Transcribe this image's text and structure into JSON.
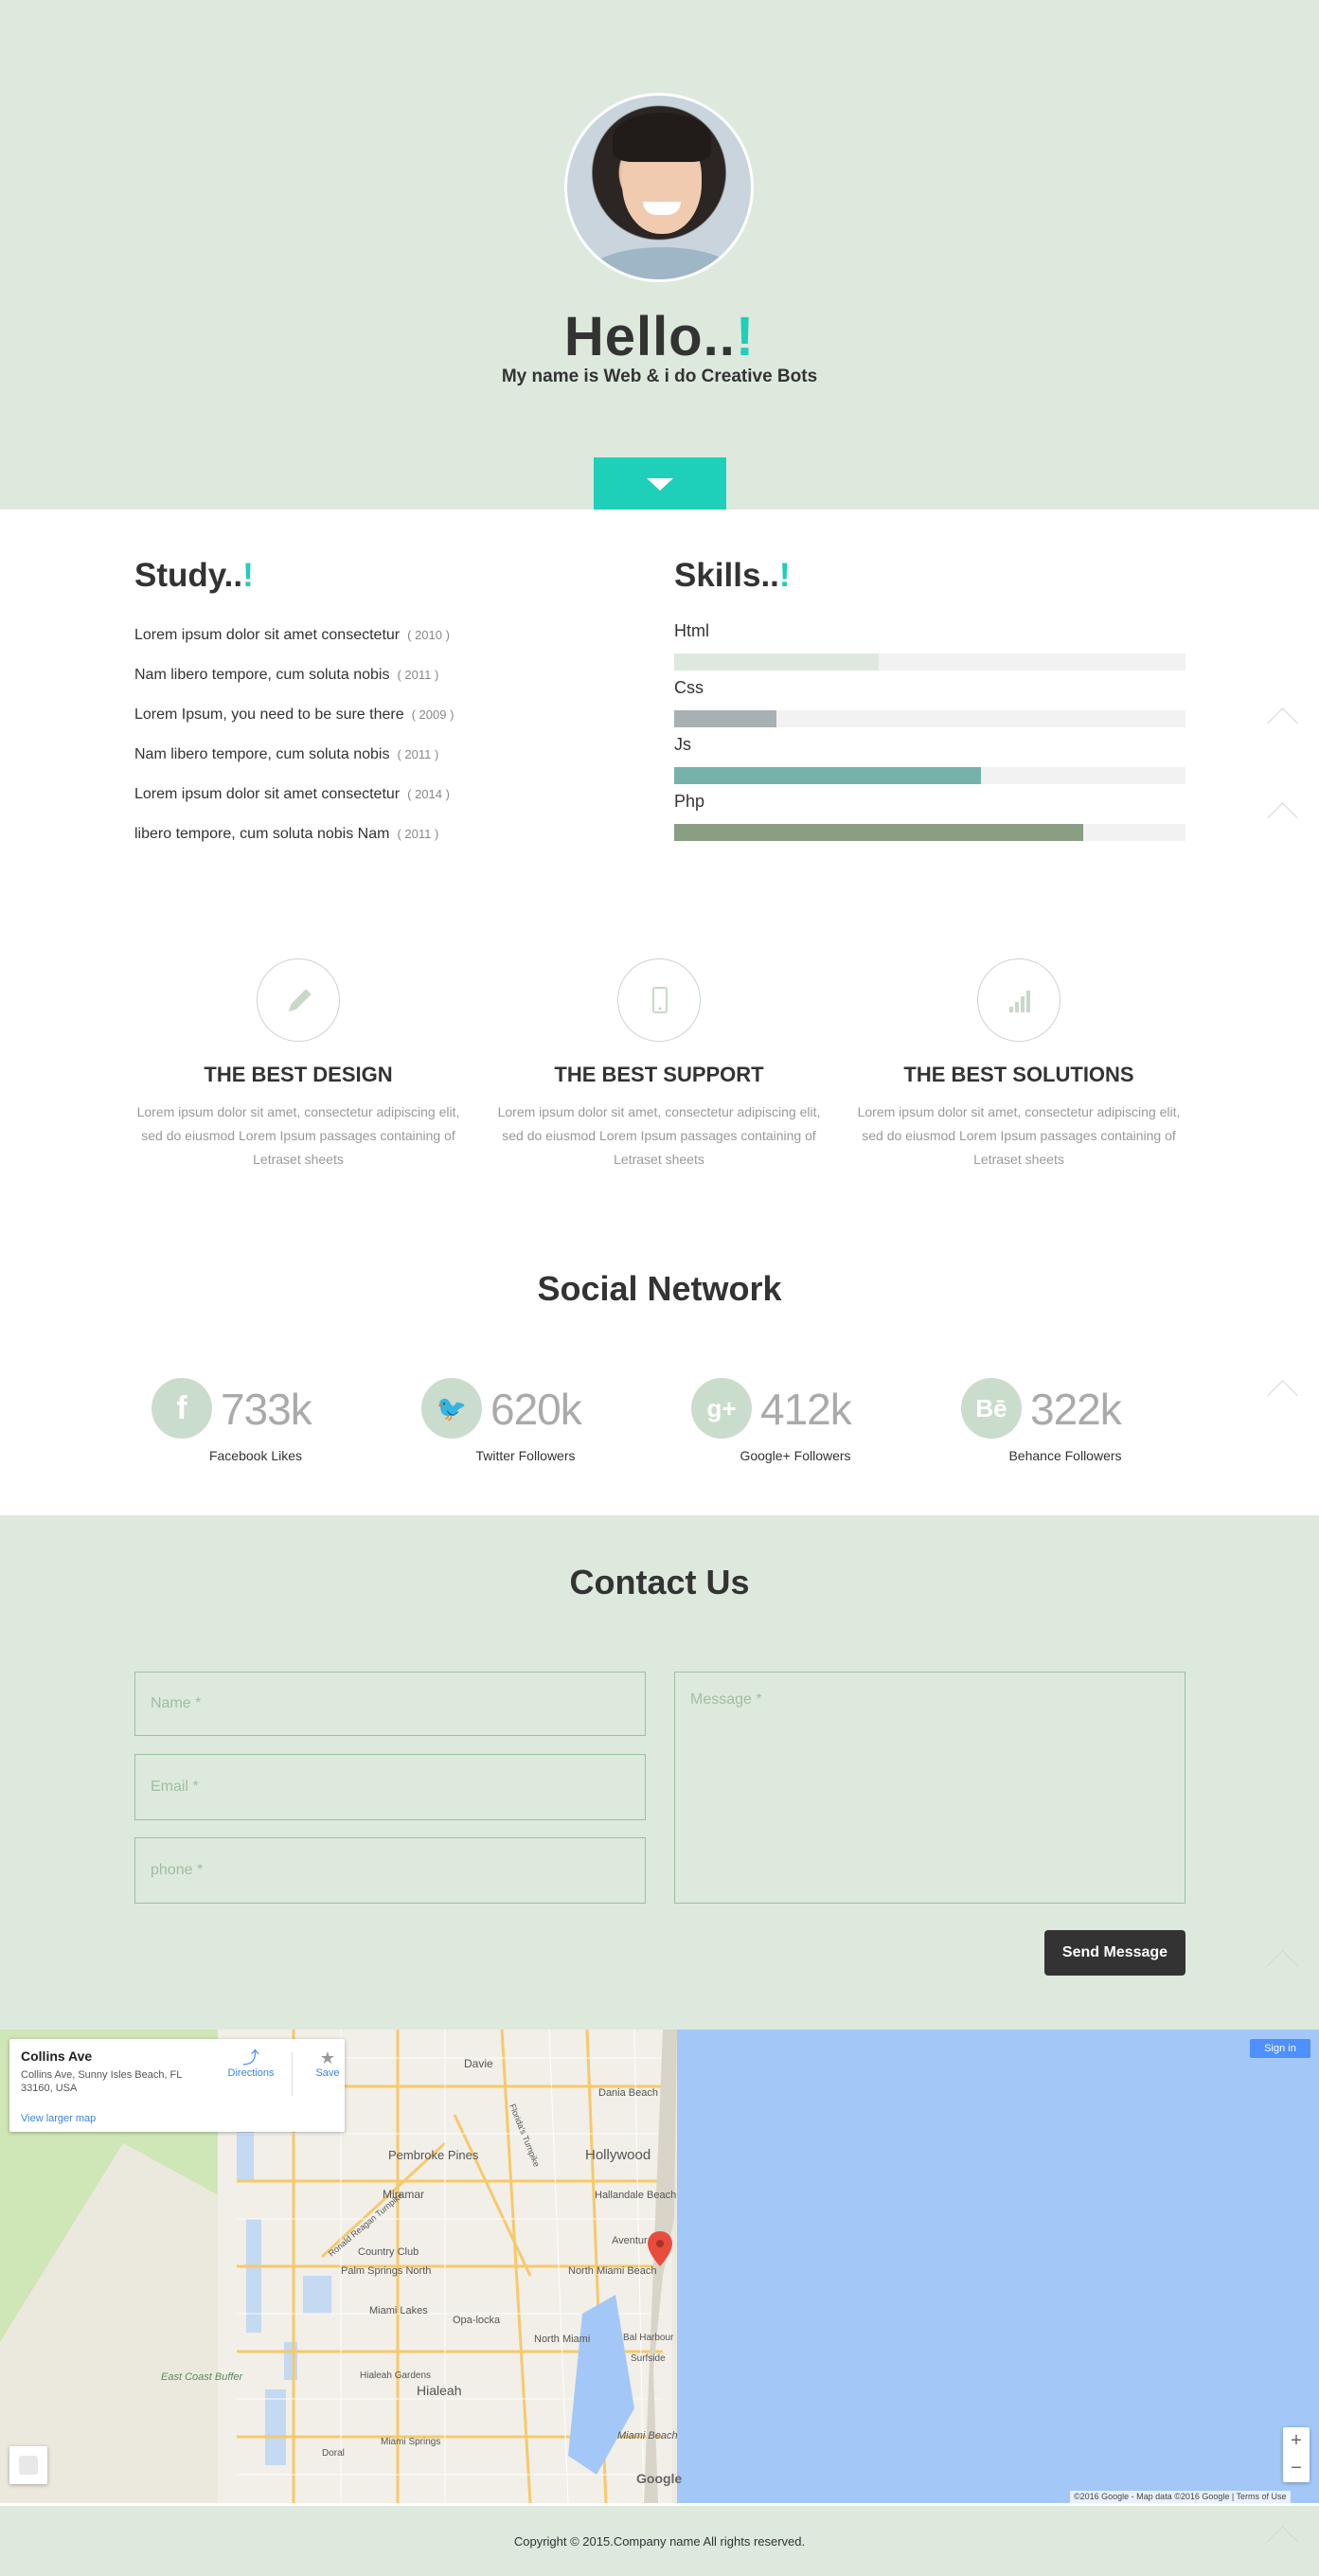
{
  "hero": {
    "title": "Hello..",
    "title_accent": "!",
    "tagline": "My name is Web & i do Creative Bots",
    "scroll_icon": "caret-down-icon"
  },
  "study": {
    "title": "Study..",
    "accent": "!",
    "items": [
      {
        "text": "Lorem ipsum dolor sit amet consectetur",
        "year": "( 2010 )"
      },
      {
        "text": "Nam libero tempore, cum soluta nobis",
        "year": "( 2011 )"
      },
      {
        "text": "Lorem Ipsum, you need to be sure there",
        "year": "( 2009 )"
      },
      {
        "text": "Nam libero tempore, cum soluta nobis",
        "year": "( 2011 )"
      },
      {
        "text": "Lorem ipsum dolor sit amet consectetur",
        "year": "( 2014 )"
      },
      {
        "text": "libero tempore, cum soluta nobis Nam",
        "year": "( 2011 )"
      }
    ]
  },
  "skills": {
    "title": "Skills..",
    "accent": "!",
    "items": [
      {
        "label": "Html",
        "level": 0.4,
        "color": "#dde9dd"
      },
      {
        "label": "Css",
        "level": 0.2,
        "color": "#a8b0b4"
      },
      {
        "label": "Js",
        "level": 0.6,
        "color": "#76b2aa"
      },
      {
        "label": "Php",
        "level": 0.8,
        "color": "#8a9e83"
      }
    ]
  },
  "features": [
    {
      "icon": "pencil-icon",
      "title": "THE BEST DESIGN",
      "text": "Lorem ipsum dolor sit amet, consectetur adipiscing elit, sed do eiusmod Lorem Ipsum passages containing of Letraset sheets"
    },
    {
      "icon": "mobile-icon",
      "title": "THE BEST SUPPORT",
      "text": "Lorem ipsum dolor sit amet, consectetur adipiscing elit, sed do eiusmod Lorem Ipsum passages containing of Letraset sheets"
    },
    {
      "icon": "signal-bars-icon",
      "title": "THE BEST SOLUTIONS",
      "text": "Lorem ipsum dolor sit amet, consectetur adipiscing elit, sed do eiusmod Lorem Ipsum passages containing of Letraset sheets"
    }
  ],
  "social": {
    "title": "Social Network",
    "items": [
      {
        "icon": "facebook-icon",
        "glyph": "f",
        "count": "733k",
        "caption": "Facebook Likes"
      },
      {
        "icon": "twitter-icon",
        "glyph": "🐦",
        "count": "620k",
        "caption": "Twitter Followers"
      },
      {
        "icon": "google-plus-icon",
        "glyph": "g+",
        "count": "412k",
        "caption": "Google+ Followers"
      },
      {
        "icon": "behance-icon",
        "glyph": "Bē",
        "count": "322k",
        "caption": "Behance Followers"
      }
    ]
  },
  "contact": {
    "title": "Contact Us",
    "name_placeholder": "Name *",
    "email_placeholder": "Email *",
    "phone_placeholder": "phone *",
    "message_placeholder": "Message *",
    "send_label": "Send Message"
  },
  "map": {
    "place_title": "Collins Ave",
    "place_address": "Collins Ave, Sunny Isles Beach, FL 33160, USA",
    "larger_map": "View larger map",
    "directions": "Directions",
    "save": "Save",
    "sign_in": "Sign in",
    "zoom_in": "+",
    "zoom_out": "−",
    "legal": "©2016 Google - Map data ©2016 Google  |  Terms of Use",
    "google": "Google",
    "labels": [
      "Davie",
      "Dania Beach",
      "Hollywood",
      "Pembroke Pines",
      "Miramar",
      "Hallandale Beach",
      "Aventura",
      "Country Club",
      "Palm Springs North",
      "North Miami Beach",
      "Miami Lakes",
      "Opa-locka",
      "North Miami",
      "Bal Harbour",
      "Surfside",
      "Hialeah Gardens",
      "Hialeah",
      "East Coast Buffer",
      "Miami Springs",
      "Doral",
      "Miami Beach",
      "Florida's Turnpike",
      "Ronald Reagan Turnpike"
    ]
  },
  "footer": {
    "copyright": "Copyright © 2015.Company name All rights reserved."
  }
}
